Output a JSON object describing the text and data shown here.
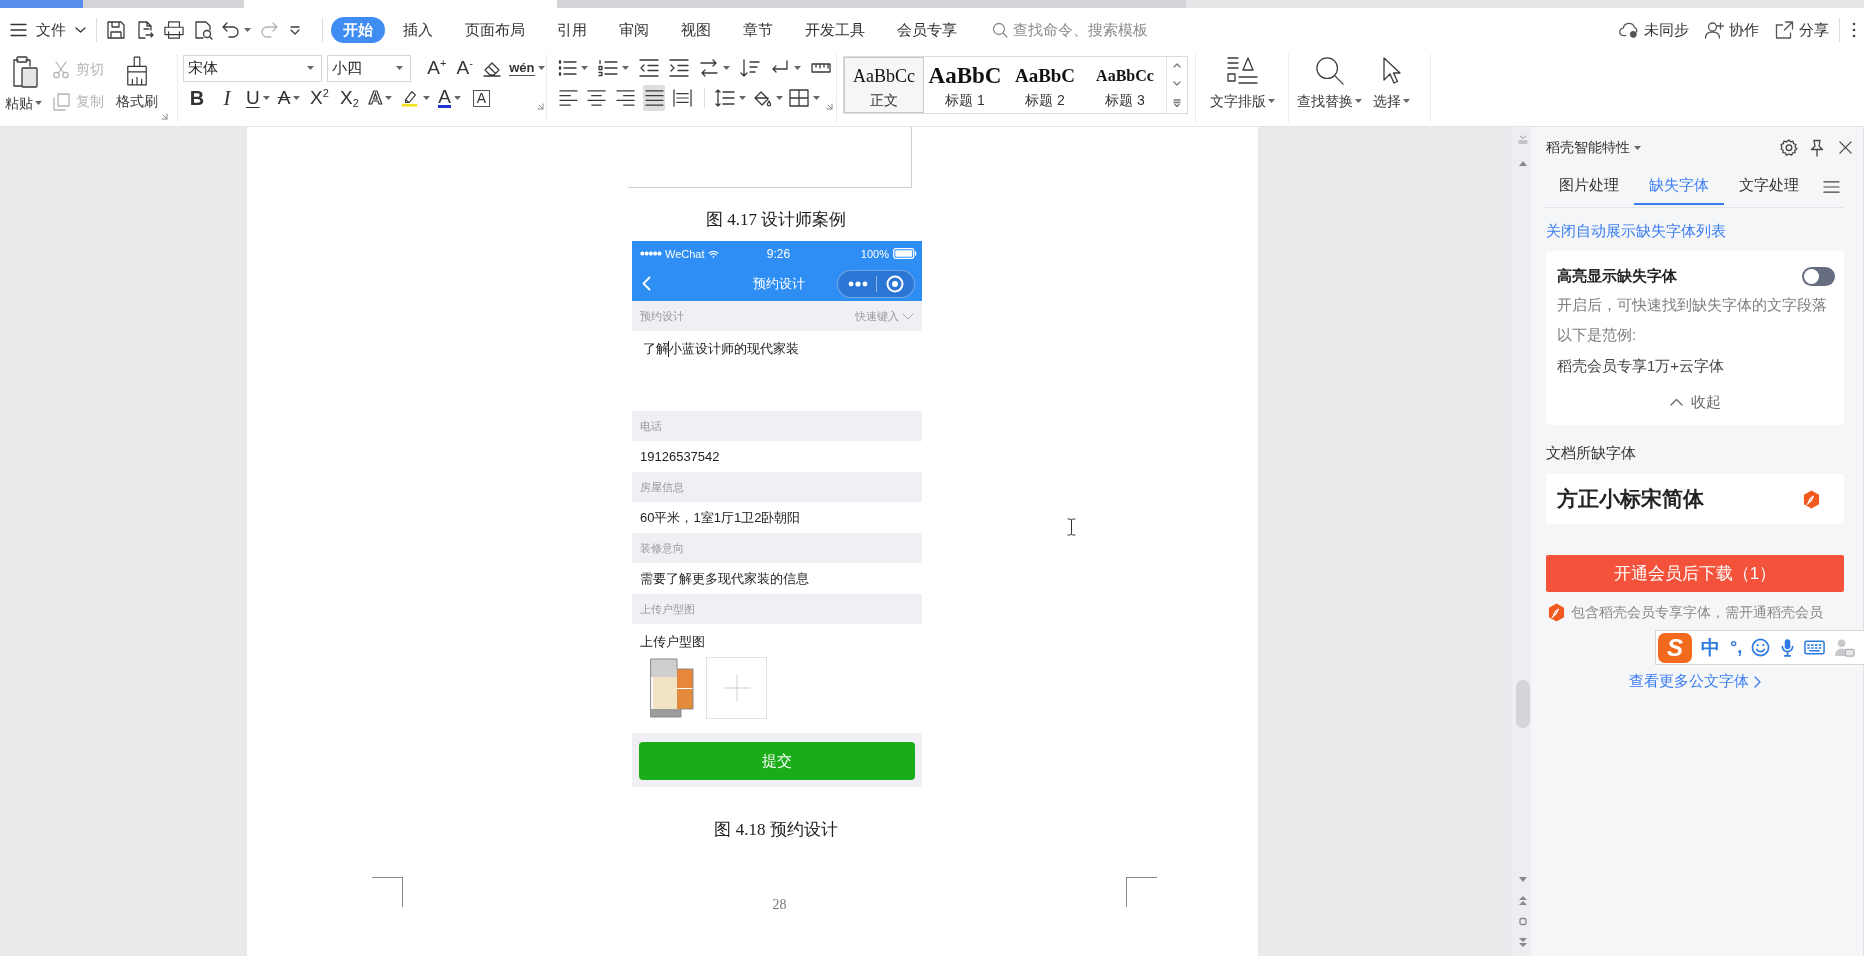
{
  "menu_bar": {
    "file_menu": "文件",
    "quick_access": {
      "undo": {
        "disabled": false
      },
      "redo": {
        "disabled": true
      }
    },
    "tabs": [
      {
        "label": "开始",
        "selected": true
      },
      {
        "label": "插入",
        "selected": false
      },
      {
        "label": "页面布局",
        "selected": false
      },
      {
        "label": "引用",
        "selected": false
      },
      {
        "label": "审阅",
        "selected": false
      },
      {
        "label": "视图",
        "selected": false
      },
      {
        "label": "章节",
        "selected": false
      },
      {
        "label": "开发工具",
        "selected": false
      },
      {
        "label": "会员专享",
        "selected": false
      }
    ],
    "search": {
      "placeholder": "查找命令、搜索模板"
    },
    "actions": [
      "未同步",
      "协作",
      "分享"
    ]
  },
  "ribbon": {
    "clipboard": {
      "paste": "粘贴",
      "cut": {
        "label": "剪切",
        "disabled": true
      },
      "copy": {
        "label": "复制",
        "disabled": true
      },
      "format_painter": "格式刷"
    },
    "font": {
      "name": "宋体",
      "size": "小四",
      "grow": "A$^{+}$",
      "shrink": "A$^{-}$",
      "phonetic": "wén",
      "bold": "B",
      "italic": "I",
      "underline": "U",
      "strikethrough": "A",
      "superscript": "X$^{2}$",
      "subscript": "X$_{2}$",
      "text_effects": "A",
      "font_color": "A",
      "char_border": "A"
    },
    "paragraph": {
      "alignments": [
        {
          "selected": false
        },
        {
          "selected": false
        },
        {
          "selected": false
        },
        {
          "selected": true
        },
        {
          "selected": false
        }
      ]
    },
    "styles": [
      {
        "sample": "AaBbCc",
        "name": "正文",
        "selected": true
      },
      {
        "sample": "AaBbC",
        "name": "标题 1",
        "selected": false
      },
      {
        "sample": "AaBbC",
        "name": "标题 2",
        "selected": false
      },
      {
        "sample": "AaBbCc",
        "name": "标题 3",
        "selected": false
      }
    ],
    "tools": [
      "文字排版",
      "查找替换",
      "选择"
    ]
  },
  "document": {
    "captions": [
      "图 4.17 设计师案例",
      "图 4.18 预约设计"
    ],
    "page_number": "28",
    "phone_screenshot": {
      "carrier": "WeChat",
      "time": "9:26",
      "battery": "100%",
      "nav_title": "预约设计",
      "sections": [
        {
          "kind": "textarea",
          "header": "预约设计",
          "hint": "快速键入",
          "value": "了解小蓝设计师的现代家装"
        },
        {
          "kind": "text",
          "header": "电话",
          "value": "19126537542"
        },
        {
          "kind": "text",
          "header": "房屋信息",
          "value": "60平米，1室1厅1卫2卧朝阳"
        },
        {
          "kind": "text",
          "header": "装修意向",
          "value": "需要了解更多现代家装的信息"
        },
        {
          "kind": "upload",
          "header": "上传户型图",
          "value": "上传户型图"
        }
      ],
      "submit": "提交"
    }
  },
  "side_panel": {
    "title": "稻壳智能特性",
    "tabs": [
      {
        "label": "图片处理",
        "selected": false
      },
      {
        "label": "缺失字体",
        "selected": true
      },
      {
        "label": "文字处理",
        "selected": false
      }
    ],
    "auto_show_link": "关闭自动展示缺失字体列表",
    "highlight_card": {
      "title": "高亮显示缺失字体",
      "on": false,
      "description": "开启后，可快速找到缺失字体的文字段落",
      "example_label": "以下是范例:",
      "example": "稻壳会员专享1万+云字体",
      "collapse": "收起"
    },
    "missing_fonts_heading": "文档所缺字体",
    "missing_fonts": [
      {
        "name": "方正小标宋简体"
      }
    ],
    "download_button": "开通会员后下载（1）",
    "note": "包含稻壳会员专享字体，需开通稻壳会员",
    "more_link": "查看更多公文字体"
  },
  "ime_toolbar": {
    "logo": "S",
    "mode": "中",
    "punctuation": "°,"
  }
}
